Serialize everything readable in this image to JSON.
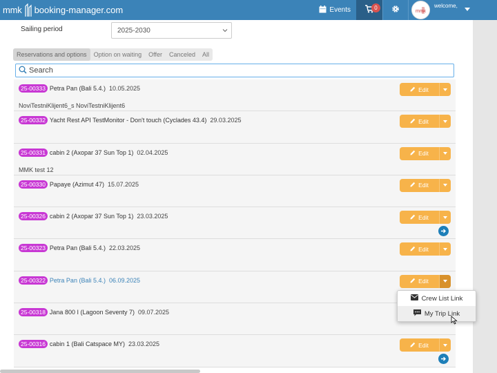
{
  "header": {
    "logo_mmk": "mmk",
    "logo_brand": "booking-manager.com",
    "events_label": "Events",
    "cart_count": "0",
    "welcome_label": "welcome,",
    "bar_color": "#3b83b8"
  },
  "filters": {
    "sailing_period_label": "Sailing period",
    "sailing_period_value": "2025-2030"
  },
  "tabs": [
    {
      "label": "Reservations and options",
      "active": true
    },
    {
      "label": "Option on waiting",
      "active": false
    },
    {
      "label": "Offer",
      "active": false
    },
    {
      "label": "Canceled",
      "active": false
    },
    {
      "label": "All",
      "active": false
    }
  ],
  "search": {
    "placeholder": "Search"
  },
  "edit_label": "Edit",
  "reservations": [
    {
      "id": "25-00333",
      "boat": "Petra Pan (Bali 5.4.)",
      "date": "10.05.2025",
      "client": "NoviTestniKlijent6_s NoviTestniKlijent6"
    },
    {
      "id": "25-00332",
      "boat": "Yacht Rest API TestMonitor - Don't touch (Cyclades 43.4)",
      "date": "29.03.2025",
      "client": ""
    },
    {
      "id": "25-00331",
      "boat": "cabin 2 (Axopar 37 Sun Top 1)",
      "date": "02.04.2025",
      "client": "MMK test 12"
    },
    {
      "id": "25-00330",
      "boat": "Papaye (Azimut 47)",
      "date": "15.07.2025",
      "client": ""
    },
    {
      "id": "25-00326",
      "boat": "cabin 2 (Axopar 37 Sun Top 1)",
      "date": "23.03.2025",
      "client": "",
      "arrow": true
    },
    {
      "id": "25-00323",
      "boat": "Petra Pan (Bali 5.4.)",
      "date": "22.03.2025",
      "client": ""
    },
    {
      "id": "25-00322",
      "boat": "Petra Pan (Bali 5.4.)",
      "date": "06.09.2025",
      "client": "",
      "highlight": true,
      "open": true
    },
    {
      "id": "25-00318",
      "boat": "Jana 800 I (Lagoon Seventy 7)",
      "date": "09.07.2025",
      "client": "",
      "hide_edit": true
    },
    {
      "id": "25-00316",
      "boat": "cabin 1 (Bali Catspace MY)",
      "date": "23.03.2025",
      "client": "",
      "arrow": true
    }
  ],
  "dropdown": {
    "items": [
      {
        "label": "Crew List Link",
        "icon": "envelope-icon"
      },
      {
        "label": "My Trip Link",
        "icon": "comment-icon"
      }
    ]
  },
  "colors": {
    "reservation_badge": "#c838d4",
    "edit_button": "#f7b34a",
    "link_blue": "#3b83b8"
  }
}
